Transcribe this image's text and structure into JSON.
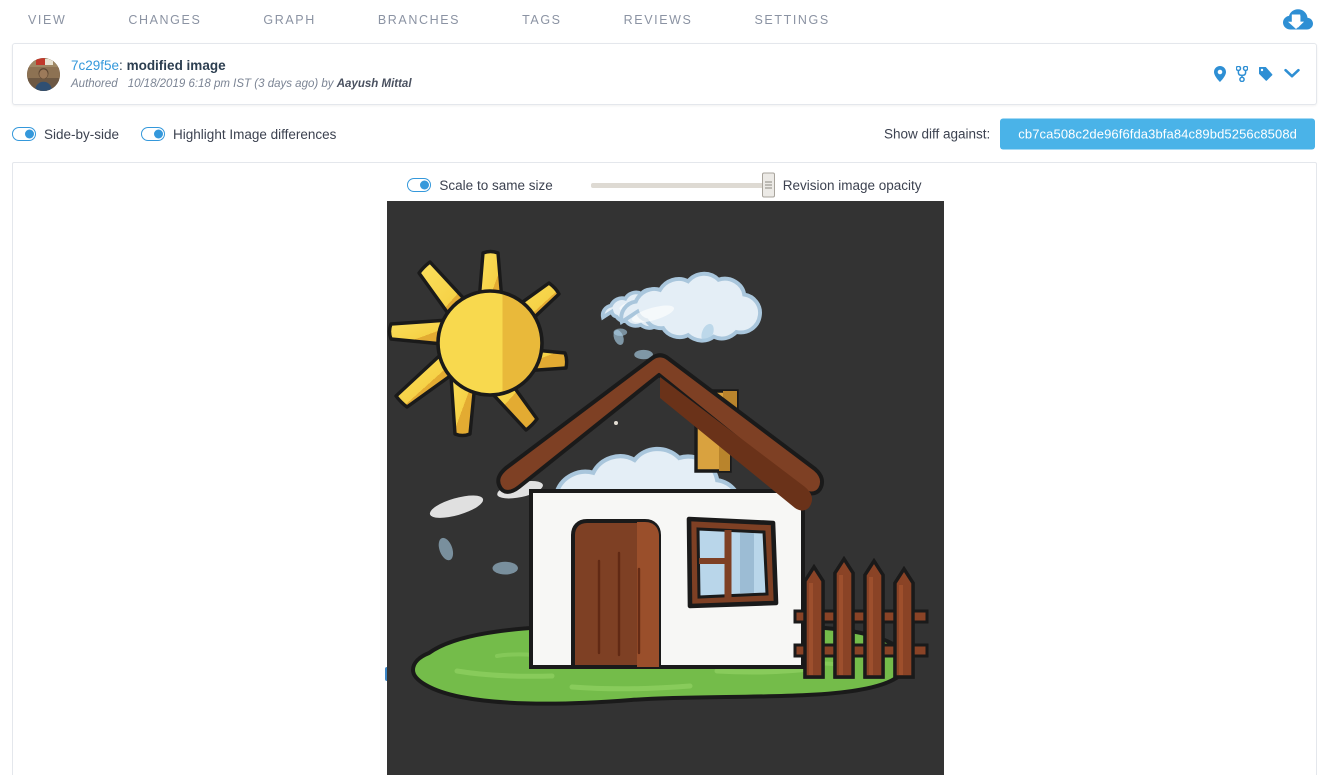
{
  "nav": {
    "tabs": [
      {
        "label": "VIEW",
        "name": "tab-view"
      },
      {
        "label": "CHANGES",
        "name": "tab-changes"
      },
      {
        "label": "GRAPH",
        "name": "tab-graph"
      },
      {
        "label": "BRANCHES",
        "name": "tab-branches"
      },
      {
        "label": "TAGS",
        "name": "tab-tags"
      },
      {
        "label": "REVIEWS",
        "name": "tab-reviews"
      },
      {
        "label": "SETTINGS",
        "name": "tab-settings"
      }
    ],
    "download_icon": "cloud-download-icon"
  },
  "commit": {
    "sha_short": "7c29f5e",
    "separator": ": ",
    "message": "modified image",
    "authored_label": "Authored",
    "date": "10/18/2019 6:18 pm IST (3 days ago) by",
    "author": "Aayush Mittal",
    "icons": [
      {
        "name": "map-marker-icon"
      },
      {
        "name": "branch-icon"
      },
      {
        "name": "tag-icon"
      },
      {
        "name": "chevron-down-icon"
      }
    ]
  },
  "options": {
    "side_by_side_label": "Side-by-side",
    "side_by_side_on": false,
    "highlight_differences_label": "Highlight Image differences",
    "highlight_differences_on": false,
    "diff_against_label": "Show diff against:",
    "diff_against_sha": "cb7ca508c2de96f6fda3bfa84c89bd5256c8508d"
  },
  "viewer": {
    "scale_to_same_size_label": "Scale to same size",
    "scale_to_same_size_on": false,
    "opacity_label": "Revision image opacity",
    "opacity_percent": 100
  },
  "colors": {
    "accent_blue": "#3498db",
    "pill_blue": "#4ab3e8",
    "nav_text": "#8b93a3",
    "canvas_background": "#333333",
    "sun_yellow": "#f7d346",
    "sun_yellow_dark": "#e8b838",
    "grass_green": "#74bc4a",
    "roof_brown": "#7e4024",
    "house_white": "#f7f7f5",
    "chimney_orange": "#d59a38",
    "cloud_white": "#dfeaf2",
    "window_blue": "#b9d6ea"
  },
  "artwork": {
    "description": "house-scene-illustration",
    "elements": [
      "sun",
      "cloud",
      "smoke-puffs",
      "chimney",
      "house",
      "door",
      "window",
      "fence",
      "grass"
    ]
  }
}
